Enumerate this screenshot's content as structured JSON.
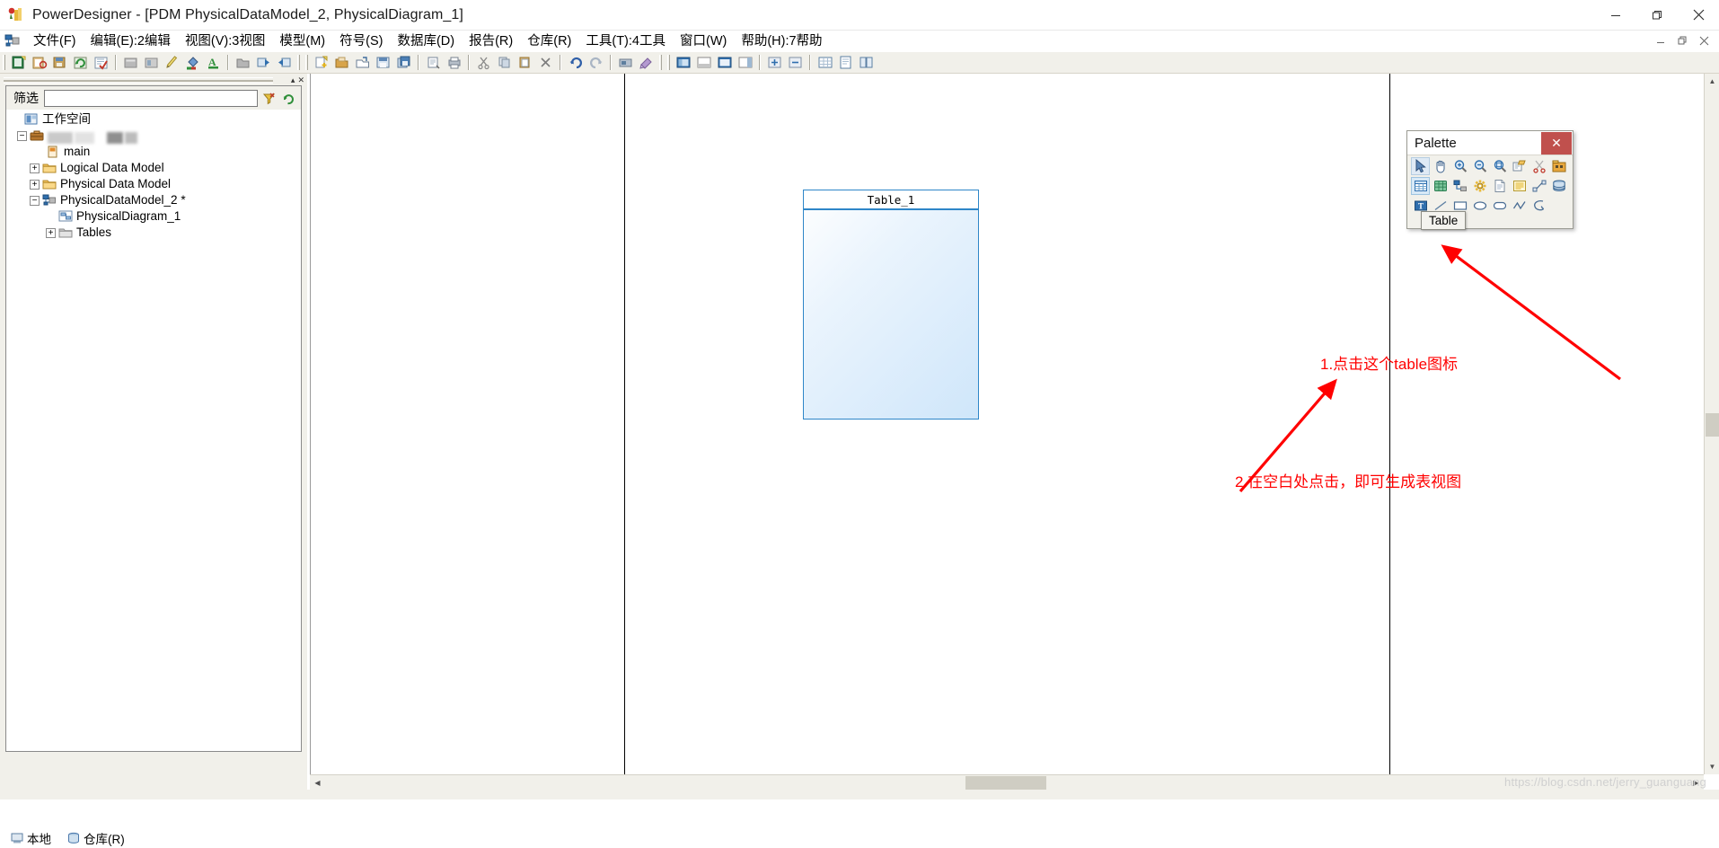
{
  "window": {
    "title": "PowerDesigner - [PDM PhysicalDataModel_2, PhysicalDiagram_1]",
    "app_icon": "powerdesigner-icon",
    "minimize": "minimize-icon",
    "maximize": "maximize-icon",
    "close": "close-icon"
  },
  "menu": {
    "system_icon": "model-icon",
    "items": [
      {
        "label": "文件(F)",
        "name": "menu-file"
      },
      {
        "label": "编辑(E):2编辑",
        "name": "menu-edit"
      },
      {
        "label": "视图(V):3视图",
        "name": "menu-view"
      },
      {
        "label": "模型(M)",
        "name": "menu-model"
      },
      {
        "label": "符号(S)",
        "name": "menu-symbol"
      },
      {
        "label": "数据库(D)",
        "name": "menu-database"
      },
      {
        "label": "报告(R)",
        "name": "menu-report"
      },
      {
        "label": "仓库(R)",
        "name": "menu-repository"
      },
      {
        "label": "工具(T):4工具",
        "name": "menu-tools"
      },
      {
        "label": "窗口(W)",
        "name": "menu-window"
      },
      {
        "label": "帮助(H):7帮助",
        "name": "menu-help"
      }
    ],
    "mdi_buttons": [
      "minimize",
      "restore",
      "close"
    ]
  },
  "toolbar": {
    "groups": [
      [
        "new-model",
        "open-workspace",
        "save-workspace",
        "refresh-workspace",
        "check-model"
      ],
      [
        "properties",
        "list-view",
        "pencil",
        "fill-color",
        "font-color"
      ],
      [
        "folder",
        "import",
        "export"
      ],
      [
        "new-document",
        "open-folder-document",
        "open-model",
        "save-model",
        "save-all"
      ],
      [
        "print-preview",
        "print"
      ],
      [
        "cut",
        "copy",
        "paste",
        "delete"
      ],
      [
        "undo",
        "redo"
      ],
      [
        "display-preferences",
        "model-options"
      ],
      [
        "toggle-browser",
        "toggle-output",
        "toggle-result",
        "toggle-palette"
      ],
      [
        "zoom-in-tool",
        "zoom-out-tool"
      ],
      [
        "grid-view",
        "page-view",
        "print-layout"
      ]
    ]
  },
  "browser": {
    "filter": {
      "label": "筛选",
      "value": "",
      "placeholder": ""
    },
    "filter_icons": [
      "filter-apply-icon",
      "filter-refresh-icon"
    ],
    "tree": [
      {
        "label": "工作空间",
        "icon": "workspace-icon",
        "indent": 0,
        "expander": "",
        "name": "tree-item-workspace"
      },
      {
        "label": "",
        "icon": "briefcase-icon",
        "indent": 1,
        "expander": "-",
        "redacted": true,
        "name": "tree-item-project"
      },
      {
        "label": "main",
        "icon": "package-icon",
        "indent": 2,
        "expander": "",
        "name": "tree-item-main"
      },
      {
        "label": "Logical Data Model",
        "icon": "folder-icon",
        "indent": 2,
        "expander": "+",
        "name": "tree-item-logical-data-model"
      },
      {
        "label": "Physical Data Model",
        "icon": "folder-icon",
        "indent": 2,
        "expander": "+",
        "name": "tree-item-physical-data-model"
      },
      {
        "label": "PhysicalDataModel_2 *",
        "icon": "pdm-icon",
        "indent": 2,
        "expander": "-",
        "name": "tree-item-physicaldatamodel-2"
      },
      {
        "label": "PhysicalDiagram_1",
        "icon": "diagram-icon",
        "indent": 3,
        "expander": "",
        "name": "tree-item-physicaldiagram-1"
      },
      {
        "label": "Tables",
        "icon": "folder-icon",
        "indent": 3,
        "expander": "+",
        "name": "tree-item-tables"
      }
    ],
    "tabs": [
      {
        "label": "本地",
        "icon": "local-icon",
        "name": "browser-tab-local",
        "active": true
      },
      {
        "label": "仓库(R)",
        "icon": "repository-icon",
        "name": "browser-tab-repository",
        "active": false
      }
    ]
  },
  "canvas": {
    "table_symbol": {
      "title": "Table_1",
      "name": "table-symbol-table-1"
    },
    "annotations": [
      {
        "text": "1.点击这个table图标",
        "name": "annotation-step-1",
        "color": "#ff0000"
      },
      {
        "text": "2.在空白处点击，即可生成表视图",
        "name": "annotation-step-2",
        "color": "#ff0000"
      }
    ],
    "watermark": "https://blog.csdn.net/jerry_guanguang"
  },
  "palette": {
    "title": "Palette",
    "close_label": "✕",
    "tooltip": "Table",
    "rows": [
      [
        "pointer-icon",
        "hand-icon",
        "zoom-in-icon",
        "zoom-out-icon",
        "zoom-fit-icon",
        "open-package-icon",
        "scissors-icon",
        "package-box-icon"
      ],
      [
        "table-icon",
        "view-icon",
        "reference-icon",
        "procedure-icon",
        "file-icon",
        "note-icon",
        "link-icon",
        "database-icon"
      ],
      [
        "text-icon",
        "line-icon",
        "rectangle-icon",
        "ellipse-icon",
        "rounded-rect-icon",
        "polyline-icon",
        "freehand-icon"
      ]
    ],
    "selected_tool": "table-icon"
  },
  "scrollbars": {
    "vertical": {
      "up": "▲",
      "down": "▼"
    },
    "horizontal": {
      "left": "◀",
      "right": "▶"
    }
  },
  "colors": {
    "accent_blue": "#2e86c8",
    "annotation_red": "#ff0000",
    "toolbar_bg": "#f1f0ea",
    "palette_close_bg": "#c0504d"
  }
}
